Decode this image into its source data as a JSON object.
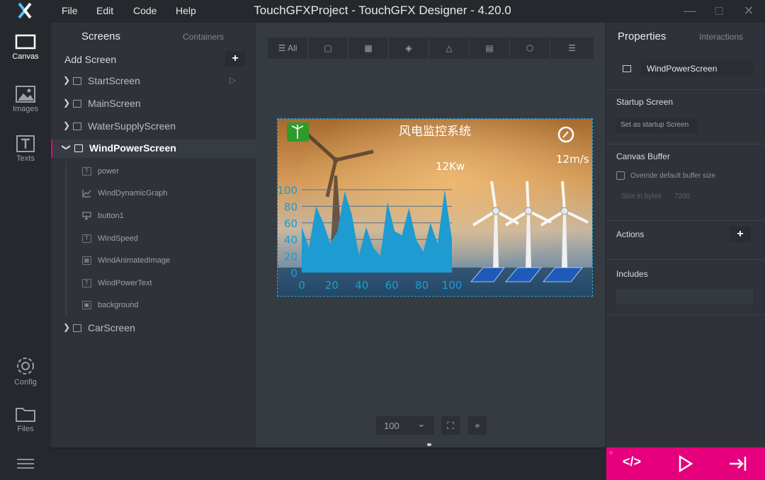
{
  "app": {
    "title": "TouchGFXProject - TouchGFX Designer - 4.20.0",
    "menu": [
      "File",
      "Edit",
      "Code",
      "Help"
    ]
  },
  "nav": [
    {
      "label": "Canvas",
      "icon": "canvas-icon"
    },
    {
      "label": "Images",
      "icon": "image-icon"
    },
    {
      "label": "Texts",
      "icon": "text-icon"
    },
    {
      "label": "Config",
      "icon": "gear-icon"
    },
    {
      "label": "Files",
      "icon": "folder-icon"
    }
  ],
  "screens_panel": {
    "tab_screens": "Screens",
    "tab_containers": "Containers",
    "add_screen": "Add Screen",
    "screens": [
      "StartScreen",
      "MainScreen",
      "WaterSupplyScreen",
      "WindPowerScreen",
      "CarScreen"
    ],
    "children": [
      "power",
      "WindDynamicGraph",
      "button1",
      "WindSpeed",
      "WindAnimatedImage",
      "WindPowerText",
      "background"
    ]
  },
  "toolbar": {
    "all": "All",
    "zoom": "100"
  },
  "preview": {
    "title": "风电监控系统",
    "power": "12Kw",
    "speed": "12m/s",
    "y_ticks": [
      "100",
      "80",
      "60",
      "40",
      "20",
      "0"
    ],
    "x_ticks": [
      "0",
      "20",
      "40",
      "60",
      "80",
      "100"
    ],
    "graph": [
      55,
      30,
      80,
      60,
      35,
      50,
      98,
      70,
      20,
      55,
      30,
      20,
      85,
      50,
      45,
      78,
      40,
      25,
      60,
      35,
      100,
      40
    ]
  },
  "properties": {
    "tab_properties": "Properties",
    "tab_interactions": "Interactions",
    "name_value": "WindPowerScreen",
    "startup_title": "Startup Screen",
    "startup_button": "Set as startup Screen",
    "buffer_title": "Canvas Buffer",
    "override_label": "Override default buffer size",
    "size_label": "Size in bytes",
    "size_value": "7200",
    "actions_title": "Actions",
    "includes_title": "Includes"
  },
  "colors": {
    "accent": "#e6007e",
    "selection": "#2aa7d8",
    "graph": "#1e9bd1"
  }
}
